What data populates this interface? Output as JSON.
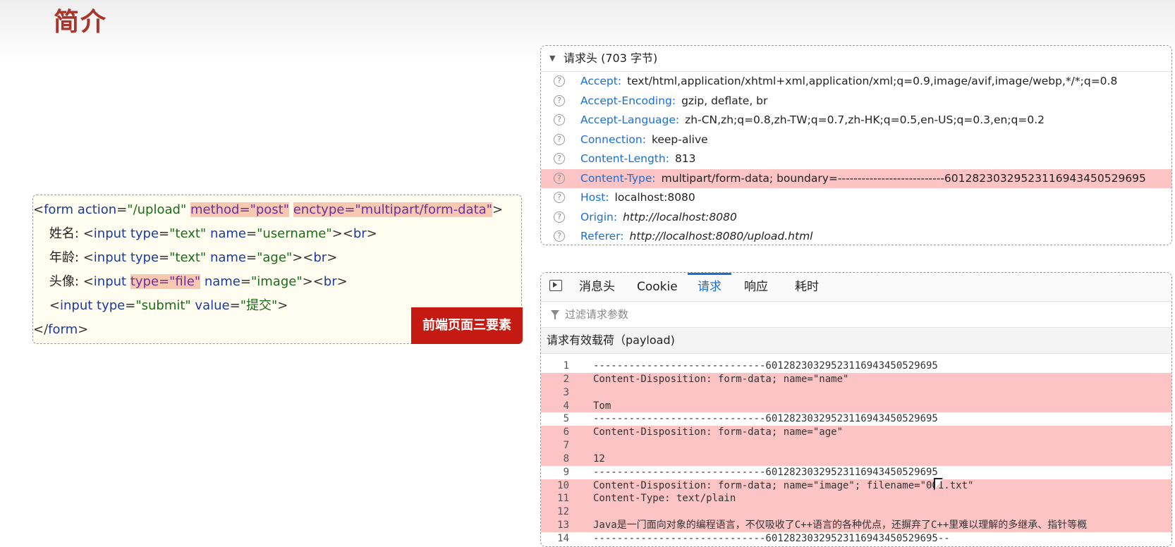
{
  "page": {
    "title": "简介"
  },
  "code": {
    "lines": [
      {
        "parts": [
          {
            "t": "<",
            "c": "c-punct"
          },
          {
            "t": "form",
            "c": "c-tag"
          },
          {
            "t": " action",
            "c": "c-attr"
          },
          {
            "t": "=",
            "c": "c-punct"
          },
          {
            "t": "\"/upload\"",
            "c": "c-val"
          },
          {
            "t": " ",
            "c": "c-punct"
          },
          {
            "t": "method=\"post\"",
            "c": "c-attr",
            "hl": true
          },
          {
            "t": " ",
            "c": "c-punct"
          },
          {
            "t": "enctype=\"multipart/form-data\"",
            "c": "c-attr",
            "hl": true
          },
          {
            "t": ">",
            "c": "c-punct"
          }
        ]
      },
      {
        "parts": [
          {
            "t": "    姓名: ",
            "c": "c-text"
          },
          {
            "t": "<",
            "c": "c-punct"
          },
          {
            "t": "input",
            "c": "c-tag"
          },
          {
            "t": " type",
            "c": "c-attr"
          },
          {
            "t": "=",
            "c": "c-punct"
          },
          {
            "t": "\"text\"",
            "c": "c-val"
          },
          {
            "t": " name",
            "c": "c-attr"
          },
          {
            "t": "=",
            "c": "c-punct"
          },
          {
            "t": "\"username\"",
            "c": "c-val"
          },
          {
            "t": "><",
            "c": "c-punct"
          },
          {
            "t": "br",
            "c": "c-tag"
          },
          {
            "t": ">",
            "c": "c-punct"
          }
        ]
      },
      {
        "parts": [
          {
            "t": "    年龄: ",
            "c": "c-text"
          },
          {
            "t": "<",
            "c": "c-punct"
          },
          {
            "t": "input",
            "c": "c-tag"
          },
          {
            "t": " type",
            "c": "c-attr"
          },
          {
            "t": "=",
            "c": "c-punct"
          },
          {
            "t": "\"text\"",
            "c": "c-val"
          },
          {
            "t": " name",
            "c": "c-attr"
          },
          {
            "t": "=",
            "c": "c-punct"
          },
          {
            "t": "\"age\"",
            "c": "c-val"
          },
          {
            "t": "><",
            "c": "c-punct"
          },
          {
            "t": "br",
            "c": "c-tag"
          },
          {
            "t": ">",
            "c": "c-punct"
          }
        ]
      },
      {
        "parts": [
          {
            "t": "    头像: ",
            "c": "c-text"
          },
          {
            "t": "<",
            "c": "c-punct"
          },
          {
            "t": "input",
            "c": "c-tag"
          },
          {
            "t": " ",
            "c": "c-punct"
          },
          {
            "t": "type=\"file\"",
            "c": "c-attr",
            "hl": true
          },
          {
            "t": " name",
            "c": "c-attr"
          },
          {
            "t": "=",
            "c": "c-punct"
          },
          {
            "t": "\"image\"",
            "c": "c-val"
          },
          {
            "t": "><",
            "c": "c-punct"
          },
          {
            "t": "br",
            "c": "c-tag"
          },
          {
            "t": ">",
            "c": "c-punct"
          }
        ]
      },
      {
        "parts": [
          {
            "t": "    ",
            "c": "c-text"
          },
          {
            "t": "<",
            "c": "c-punct"
          },
          {
            "t": "input",
            "c": "c-tag"
          },
          {
            "t": " type",
            "c": "c-attr"
          },
          {
            "t": "=",
            "c": "c-punct"
          },
          {
            "t": "\"submit\"",
            "c": "c-val"
          },
          {
            "t": " value",
            "c": "c-attr"
          },
          {
            "t": "=",
            "c": "c-punct"
          },
          {
            "t": "\"提交\"",
            "c": "c-val"
          },
          {
            "t": ">",
            "c": "c-punct"
          }
        ]
      },
      {
        "parts": [
          {
            "t": "</",
            "c": "c-punct"
          },
          {
            "t": "form",
            "c": "c-tag"
          },
          {
            "t": ">",
            "c": "c-punct"
          }
        ]
      }
    ],
    "badge": "前端页面三要素"
  },
  "headers": {
    "title": "请求头 (703 字节)",
    "rows": [
      {
        "name": "Accept",
        "value": "text/html,application/xhtml+xml,application/xml;q=0.9,image/avif,image/webp,*/*;q=0.8",
        "italic": false,
        "hl": false
      },
      {
        "name": "Accept-Encoding",
        "value": "gzip, deflate, br",
        "italic": false,
        "hl": false
      },
      {
        "name": "Accept-Language",
        "value": "zh-CN,zh;q=0.8,zh-TW;q=0.7,zh-HK;q=0.5,en-US;q=0.3,en;q=0.2",
        "italic": false,
        "hl": false
      },
      {
        "name": "Connection",
        "value": "keep-alive",
        "italic": false,
        "hl": false
      },
      {
        "name": "Content-Length",
        "value": "813",
        "italic": false,
        "hl": false
      },
      {
        "name": "Content-Type",
        "value": "multipart/form-data; boundary=---------------------------60128230329523116943450529695",
        "italic": false,
        "hl": true
      },
      {
        "name": "Host",
        "value": "localhost:8080",
        "italic": false,
        "hl": false
      },
      {
        "name": "Origin",
        "value": "http://localhost:8080",
        "italic": true,
        "hl": false
      },
      {
        "name": "Referer",
        "value": "http://localhost:8080/upload.html",
        "italic": true,
        "hl": false
      }
    ]
  },
  "request": {
    "tabs": [
      {
        "label": "消息头",
        "active": false
      },
      {
        "label": "Cookie",
        "active": false
      },
      {
        "label": "请求",
        "active": true
      },
      {
        "label": "响应",
        "active": false
      },
      {
        "label": "耗时",
        "active": false
      }
    ],
    "filter_placeholder": "过滤请求参数",
    "payload_title": "请求有效载荷（payload)",
    "lines": [
      {
        "n": "1",
        "text": "-----------------------------60128230329523116943450529695",
        "hl": false
      },
      {
        "n": "2",
        "text": "Content-Disposition: form-data; name=\"name\"",
        "hl": true
      },
      {
        "n": "3",
        "text": "",
        "hl": true
      },
      {
        "n": "4",
        "text": "Tom",
        "hl": true
      },
      {
        "n": "5",
        "text": "-----------------------------60128230329523116943450529695",
        "hl": false
      },
      {
        "n": "6",
        "text": "Content-Disposition: form-data; name=\"age\"",
        "hl": true
      },
      {
        "n": "7",
        "text": "",
        "hl": true
      },
      {
        "n": "8",
        "text": "12",
        "hl": true
      },
      {
        "n": "9",
        "text": "-----------------------------60128230329523116943450529695",
        "hl": false
      },
      {
        "n": "10",
        "text": "Content-Disposition: form-data; name=\"image\"; filename=\"001.txt\"",
        "hl": true
      },
      {
        "n": "11",
        "text": "Content-Type: text/plain",
        "hl": true
      },
      {
        "n": "12",
        "text": "",
        "hl": true
      },
      {
        "n": "13",
        "text": "Java是一门面向对象的编程语言，不仅吸收了C++语言的各种优点，还摒弃了C++里难以理解的多继承、指针等概",
        "hl": true
      },
      {
        "n": "14",
        "text": "-----------------------------60128230329523116943450529695--",
        "hl": false
      }
    ]
  }
}
